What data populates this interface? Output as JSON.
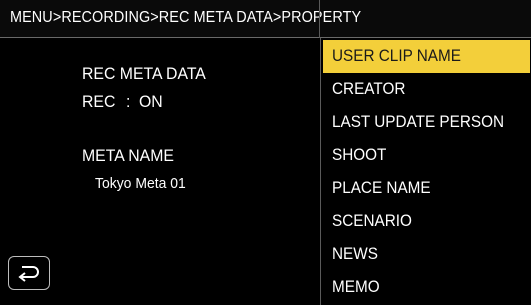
{
  "header": {
    "breadcrumb": "MENU>RECORDING>REC META DATA>PROPERTY"
  },
  "info": {
    "section_title": "REC META DATA",
    "rec_label": "REC",
    "rec_sep": ":",
    "rec_value": "ON",
    "meta_name_label": "META NAME",
    "meta_name_value": "Tokyo Meta 01"
  },
  "footer": {
    "back_icon": "return-arrow-icon"
  },
  "menu": {
    "selected_index": 0,
    "items": [
      {
        "label": "USER CLIP NAME"
      },
      {
        "label": "CREATOR"
      },
      {
        "label": "LAST UPDATE PERSON"
      },
      {
        "label": "SHOOT"
      },
      {
        "label": "PLACE NAME"
      },
      {
        "label": "SCENARIO"
      },
      {
        "label": "NEWS"
      },
      {
        "label": "MEMO"
      }
    ]
  },
  "colors": {
    "background": "#000000",
    "highlight": "#f3cf3a",
    "text": "#ffffff",
    "divider": "#5a5a5a"
  }
}
